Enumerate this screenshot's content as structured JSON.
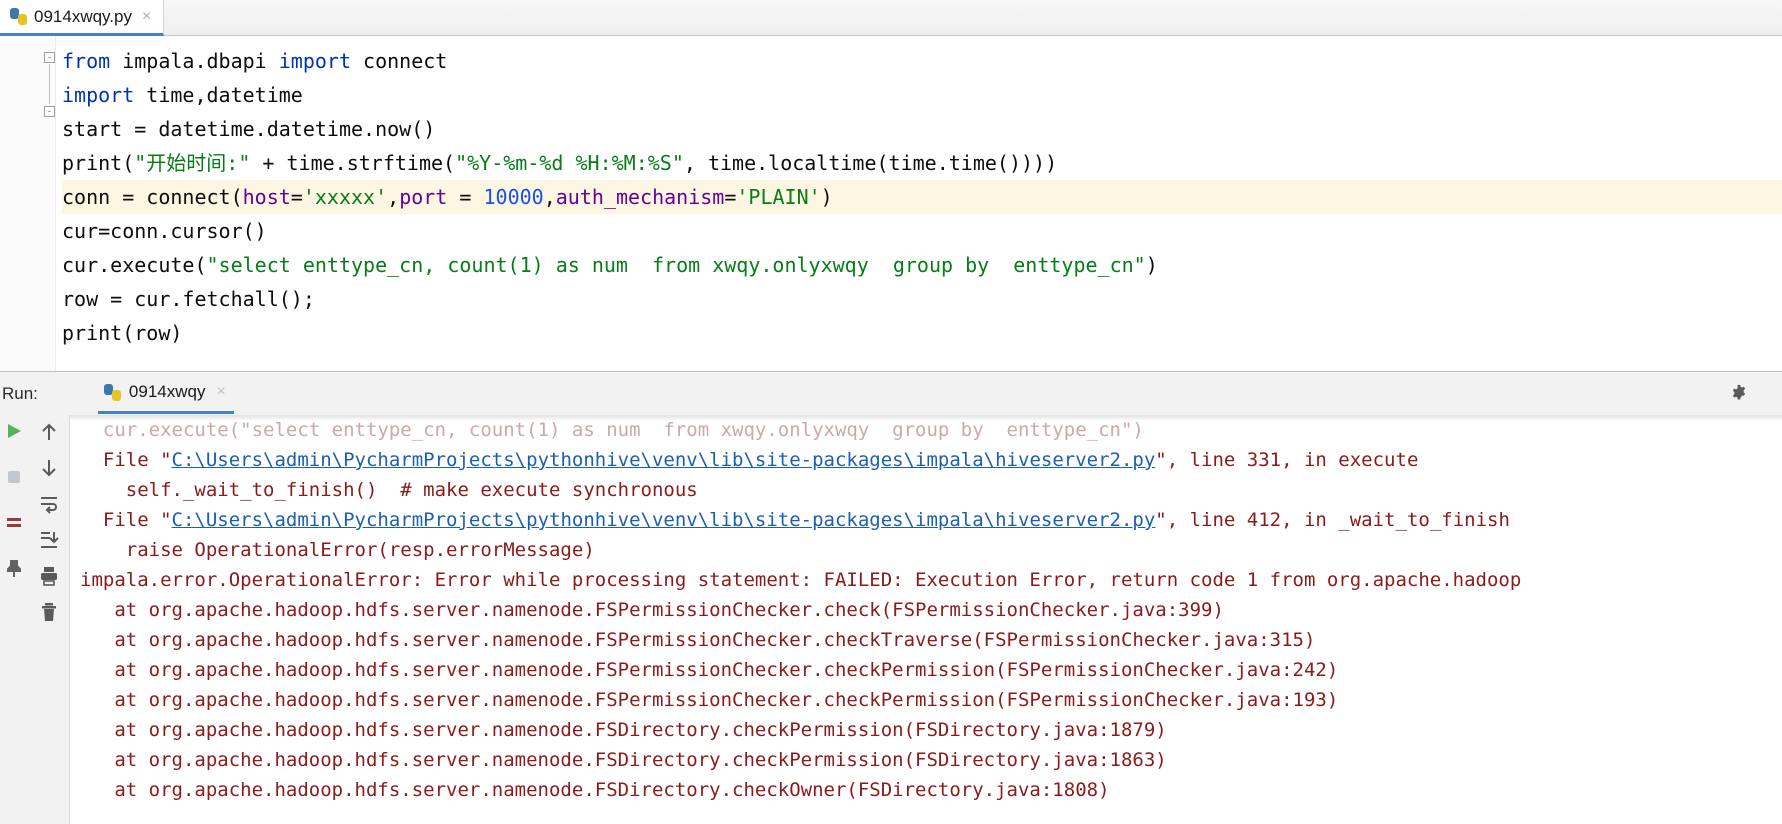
{
  "editor_tab": {
    "filename": "0914xwqy.py",
    "close_label": "×",
    "icon": "python-file-icon"
  },
  "code": {
    "lines": [
      [
        {
          "t": "from",
          "c": "kw"
        },
        {
          "t": " impala.dbapi ",
          "c": "plain"
        },
        {
          "t": "import",
          "c": "kw"
        },
        {
          "t": " connect",
          "c": "plain"
        }
      ],
      [
        {
          "t": "import",
          "c": "kw"
        },
        {
          "t": " time,datetime",
          "c": "plain"
        }
      ],
      [
        {
          "t": "start = datetime.datetime.now()",
          "c": "plain"
        }
      ],
      [
        {
          "t": "print(",
          "c": "plain"
        },
        {
          "t": "\"开始时间:\"",
          "c": "str"
        },
        {
          "t": " + time.strftime(",
          "c": "plain"
        },
        {
          "t": "\"%Y-%m-%d %H:%M:%S\"",
          "c": "str"
        },
        {
          "t": ", time.localtime(time.time())))",
          "c": "plain"
        }
      ],
      [
        {
          "t": "conn = connect(",
          "c": "plain"
        },
        {
          "t": "host",
          "c": "kwarg"
        },
        {
          "t": "=",
          "c": "plain"
        },
        {
          "t": "'xxxxx'",
          "c": "str"
        },
        {
          "t": ",",
          "c": "plain"
        },
        {
          "t": "port",
          "c": "kwarg"
        },
        {
          "t": " = ",
          "c": "plain"
        },
        {
          "t": "10000",
          "c": "num"
        },
        {
          "t": ",",
          "c": "plain"
        },
        {
          "t": "auth_mechanism",
          "c": "kwarg"
        },
        {
          "t": "=",
          "c": "plain"
        },
        {
          "t": "'PLAIN'",
          "c": "str"
        },
        {
          "t": ")",
          "c": "plain"
        }
      ],
      [
        {
          "t": "cur=conn.cursor()",
          "c": "plain"
        }
      ],
      [
        {
          "t": "cur.execute(",
          "c": "plain"
        },
        {
          "t": "\"select enttype_cn, count(1) as num  from xwqy.onlyxwqy  group by  enttype_cn\"",
          "c": "str"
        },
        {
          "t": ")",
          "c": "plain"
        }
      ],
      [
        {
          "t": "row = cur.fetchall();",
          "c": "plain"
        }
      ],
      [
        {
          "t": "print(row)",
          "c": "plain"
        }
      ]
    ],
    "highlighted_line_index": 4,
    "fold_markers": [
      "-",
      "-"
    ]
  },
  "run_window": {
    "label": "Run:",
    "tab_name": "0914xwqy",
    "tab_icon": "python-file-icon",
    "tab_close": "×",
    "settings_icon": "gear-icon",
    "left_icons": [
      {
        "name": "run-icon"
      },
      {
        "name": "stop-icon"
      },
      {
        "name": "rerun-failed-icon"
      },
      {
        "name": "pin-icon"
      }
    ],
    "toolbar_icons": [
      {
        "name": "up-arrow-icon"
      },
      {
        "name": "down-arrow-icon"
      },
      {
        "name": "soft-wrap-icon"
      },
      {
        "name": "scroll-to-end-icon"
      },
      {
        "name": "print-icon"
      },
      {
        "name": "trash-icon"
      }
    ]
  },
  "console": {
    "lines": [
      {
        "kind": "faded",
        "text": "  cur.execute(\"select enttype_cn, count(1) as num  from xwqy.onlyxwqy  group by  enttype_cn\")"
      },
      {
        "kind": "file",
        "prefix": "  File \"",
        "link": "C:\\Users\\admin\\PycharmProjects\\pythonhive\\venv\\lib\\site-packages\\impala\\hiveserver2.py",
        "suffix": "\", line 331, in execute"
      },
      {
        "kind": "plain",
        "text": "    self._wait_to_finish()  # make execute synchronous"
      },
      {
        "kind": "file",
        "prefix": "  File \"",
        "link": "C:\\Users\\admin\\PycharmProjects\\pythonhive\\venv\\lib\\site-packages\\impala\\hiveserver2.py",
        "suffix": "\", line 412, in _wait_to_finish"
      },
      {
        "kind": "plain",
        "text": "    raise OperationalError(resp.errorMessage)"
      },
      {
        "kind": "plain",
        "text": "impala.error.OperationalError: Error while processing statement: FAILED: Execution Error, return code 1 from org.apache.hadoop"
      },
      {
        "kind": "plain",
        "text": "   at org.apache.hadoop.hdfs.server.namenode.FSPermissionChecker.check(FSPermissionChecker.java:399)"
      },
      {
        "kind": "plain",
        "text": "   at org.apache.hadoop.hdfs.server.namenode.FSPermissionChecker.checkTraverse(FSPermissionChecker.java:315)"
      },
      {
        "kind": "plain",
        "text": "   at org.apache.hadoop.hdfs.server.namenode.FSPermissionChecker.checkPermission(FSPermissionChecker.java:242)"
      },
      {
        "kind": "plain",
        "text": "   at org.apache.hadoop.hdfs.server.namenode.FSPermissionChecker.checkPermission(FSPermissionChecker.java:193)"
      },
      {
        "kind": "plain",
        "text": "   at org.apache.hadoop.hdfs.server.namenode.FSDirectory.checkPermission(FSDirectory.java:1879)"
      },
      {
        "kind": "plain",
        "text": "   at org.apache.hadoop.hdfs.server.namenode.FSDirectory.checkPermission(FSDirectory.java:1863)"
      },
      {
        "kind": "plain",
        "text": "   at org.apache.hadoop.hdfs.server.namenode.FSDirectory.checkOwner(FSDirectory.java:1808)"
      }
    ]
  },
  "colors": {
    "keyword": "#0033b3",
    "string": "#067d17",
    "number": "#1750eb",
    "kwarg": "#660099",
    "error": "#8b1a1a",
    "link": "#1a5fb4",
    "tab_accent": "#4083c9",
    "highlight_row": "#fdf6e3"
  }
}
